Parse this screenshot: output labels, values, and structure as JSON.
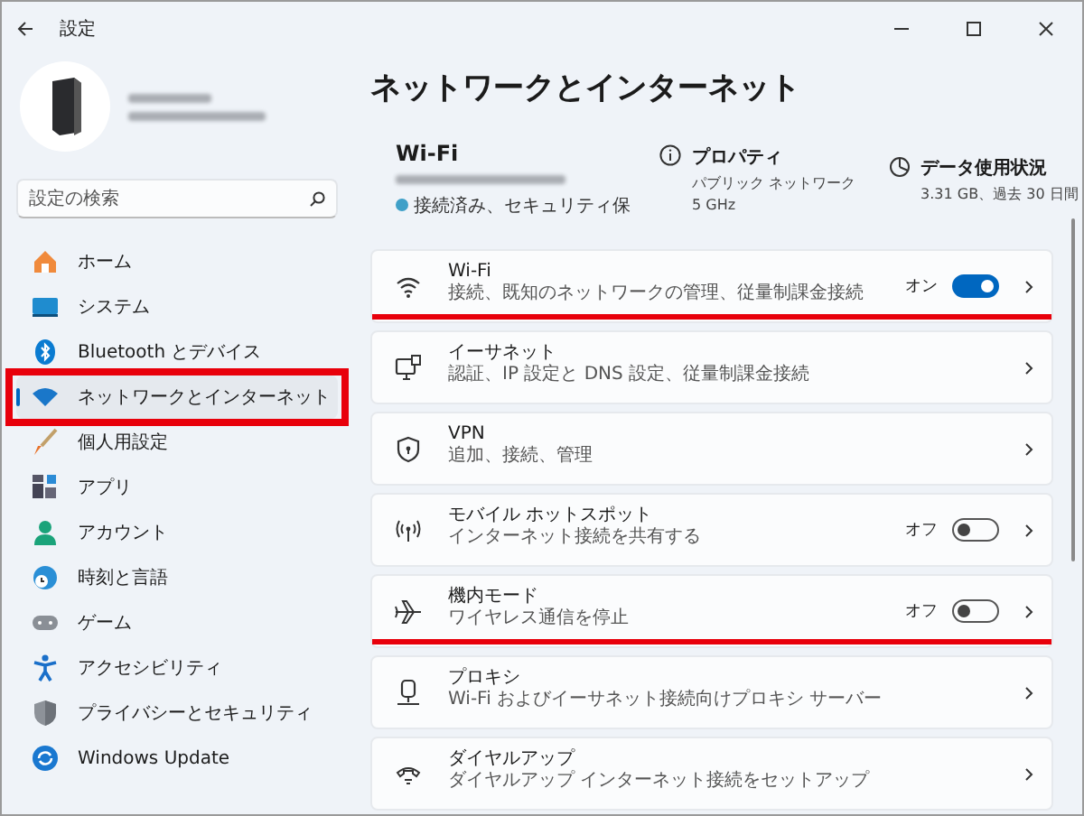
{
  "window": {
    "title": "設定"
  },
  "search": {
    "placeholder": "設定の検索"
  },
  "sidebar": {
    "items": [
      {
        "label": "ホーム",
        "selected": false,
        "highlighted": false
      },
      {
        "label": "システム",
        "selected": false,
        "highlighted": false
      },
      {
        "label": "Bluetooth とデバイス",
        "selected": false,
        "highlighted": false
      },
      {
        "label": "ネットワークとインターネット",
        "selected": true,
        "highlighted": true
      },
      {
        "label": "個人用設定",
        "selected": false,
        "highlighted": false
      },
      {
        "label": "アプリ",
        "selected": false,
        "highlighted": false
      },
      {
        "label": "アカウント",
        "selected": false,
        "highlighted": false
      },
      {
        "label": "時刻と言語",
        "selected": false,
        "highlighted": false
      },
      {
        "label": "ゲーム",
        "selected": false,
        "highlighted": false
      },
      {
        "label": "アクセシビリティ",
        "selected": false,
        "highlighted": false
      },
      {
        "label": "プライバシーとセキュリティ",
        "selected": false,
        "highlighted": false
      },
      {
        "label": "Windows Update",
        "selected": false,
        "highlighted": false
      }
    ]
  },
  "page": {
    "title": "ネットワークとインターネット"
  },
  "connection": {
    "name": "Wi-Fi",
    "status": "接続済み、セキュリティ保",
    "properties": {
      "title": "プロパティ",
      "lines": [
        "パブリック ネットワーク",
        "5 GHz"
      ]
    },
    "data_usage": {
      "title": "データ使用状況",
      "lines": [
        "3.31 GB、過去 30 日間"
      ]
    }
  },
  "rows": [
    {
      "kind": "toggle",
      "title": "Wi-Fi",
      "subtitle": "接続、既知のネットワークの管理、従量制課金接続",
      "state_label": "オン",
      "on": true,
      "highlighted": true
    },
    {
      "kind": "link",
      "title": "イーサネット",
      "subtitle": "認証、IP 設定と DNS 設定、従量制課金接続",
      "highlighted": false
    },
    {
      "kind": "link",
      "title": "VPN",
      "subtitle": "追加、接続、管理",
      "highlighted": false
    },
    {
      "kind": "toggle",
      "title": "モバイル ホットスポット",
      "subtitle": "インターネット接続を共有する",
      "state_label": "オフ",
      "on": false,
      "highlighted": false
    },
    {
      "kind": "toggle",
      "title": "機内モード",
      "subtitle": "ワイヤレス通信を停止",
      "state_label": "オフ",
      "on": false,
      "highlighted": true
    },
    {
      "kind": "link",
      "title": "プロキシ",
      "subtitle": "Wi-Fi およびイーサネット接続向けプロキシ サーバー",
      "highlighted": false
    },
    {
      "kind": "link",
      "title": "ダイヤルアップ",
      "subtitle": "ダイヤルアップ インターネット接続をセットアップ",
      "highlighted": false
    }
  ]
}
